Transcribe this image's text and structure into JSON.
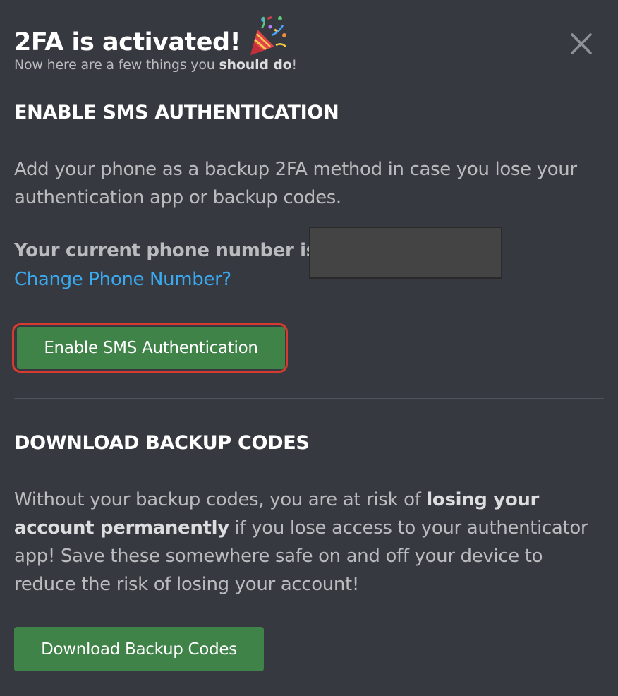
{
  "header": {
    "title": "2FA is activated!",
    "subtitle_prefix": "Now here are a few things you ",
    "subtitle_bold": "should do",
    "subtitle_suffix": "!",
    "party_icon": "party-popper-icon",
    "close_icon": "close-icon"
  },
  "sms_section": {
    "title": "ENABLE SMS AUTHENTICATION",
    "description": "Add your phone as a backup 2FA method in case you lose your authentication app or backup codes.",
    "phone_label": "Your current phone number is:",
    "phone_value": "",
    "change_link": "Change Phone Number?",
    "button_label": "Enable SMS Authentication"
  },
  "backup_section": {
    "title": "DOWNLOAD BACKUP CODES",
    "desc_part1": "Without your backup codes, you are at risk of ",
    "desc_bold": "losing your account permanently",
    "desc_part2": " if you lose access to your authenticator app! Save these somewhere safe on and off your device to reduce the risk of losing your account!",
    "button_label": "Download Backup Codes"
  },
  "colors": {
    "background": "#36393f",
    "button_green": "#3f8349",
    "link_blue": "#3ba9f0",
    "highlight_red": "#d53b2e",
    "text_muted": "#b9bbbe"
  }
}
